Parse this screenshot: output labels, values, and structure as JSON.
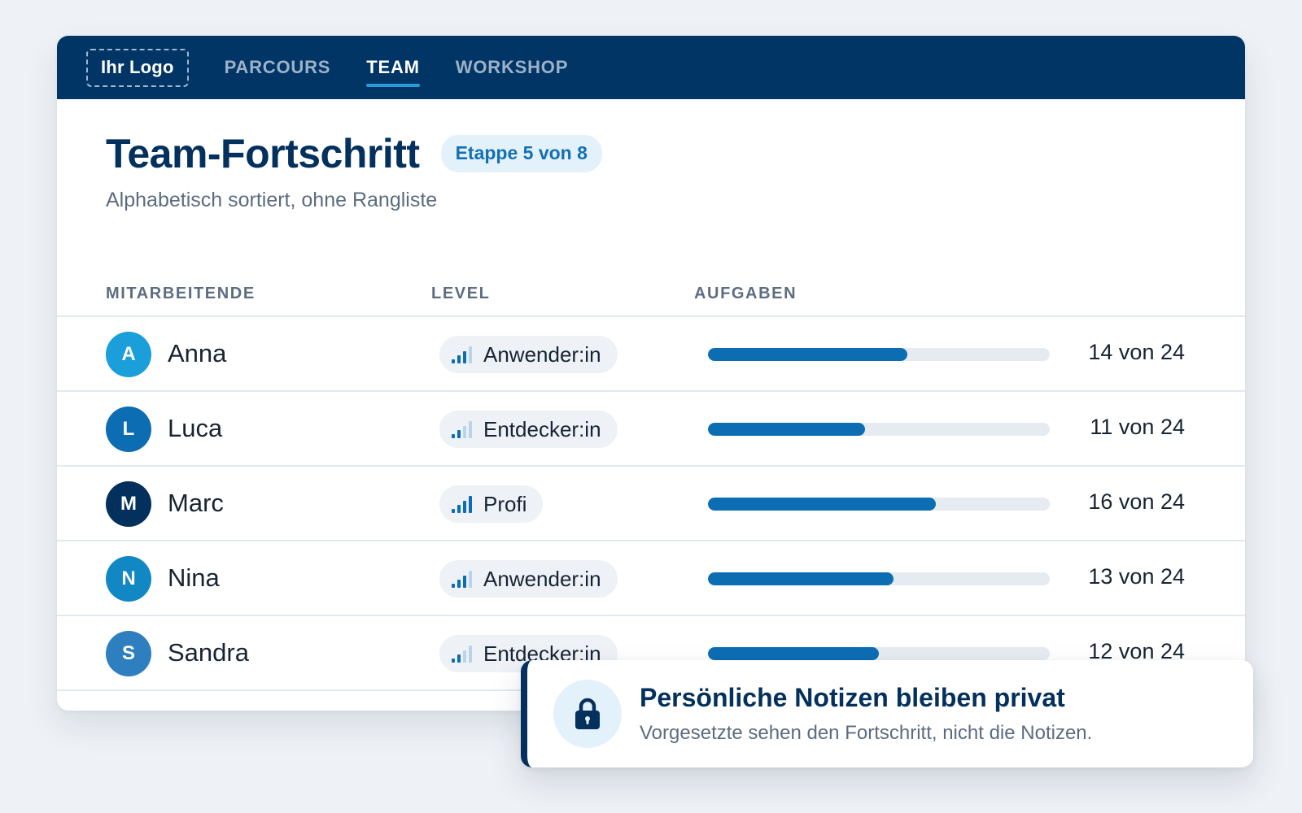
{
  "nav": {
    "logo": "Ihr Logo",
    "tabs": [
      {
        "label": "PARCOURS",
        "active": false
      },
      {
        "label": "TEAM",
        "active": true
      },
      {
        "label": "WORKSHOP",
        "active": false
      }
    ]
  },
  "header": {
    "title": "Team-Fortschritt",
    "stage_badge": "Etappe 5 von 8",
    "subtitle": "Alphabetisch sortiert, ohne Rangliste"
  },
  "table": {
    "columns": {
      "member": "MITARBEITENDE",
      "level": "LEVEL",
      "tasks": "AUFGABEN"
    },
    "rows": [
      {
        "initial": "A",
        "name": "Anna",
        "level": "Anwender:in",
        "level_rank": 3,
        "done": 14,
        "total": 24,
        "count_text": "14 von 24",
        "avatar_color": "#1a9fdb"
      },
      {
        "initial": "L",
        "name": "Luca",
        "level": "Entdecker:in",
        "level_rank": 2,
        "done": 11,
        "total": 24,
        "count_text": "11 von 24",
        "avatar_color": "#0d6db3"
      },
      {
        "initial": "M",
        "name": "Marc",
        "level": "Profi",
        "level_rank": 4,
        "done": 16,
        "total": 24,
        "count_text": "16 von 24",
        "avatar_color": "#03305c"
      },
      {
        "initial": "N",
        "name": "Nina",
        "level": "Anwender:in",
        "level_rank": 3,
        "done": 13,
        "total": 24,
        "count_text": "13 von 24",
        "avatar_color": "#1187c3"
      },
      {
        "initial": "S",
        "name": "Sandra",
        "level": "Entdecker:in",
        "level_rank": 2,
        "done": 12,
        "total": 24,
        "count_text": "12 von 24",
        "avatar_color": "#2e7fc0"
      }
    ]
  },
  "notice": {
    "icon": "lock-icon",
    "title": "Persönliche Notizen bleiben privat",
    "text": "Vorgesetzte sehen den Fortschritt, nicht die Notizen."
  },
  "colors": {
    "navbar": "#003566",
    "brand_dark": "#03305c",
    "accent": "#0d6db3",
    "badge_bg": "#e3f1fb"
  }
}
